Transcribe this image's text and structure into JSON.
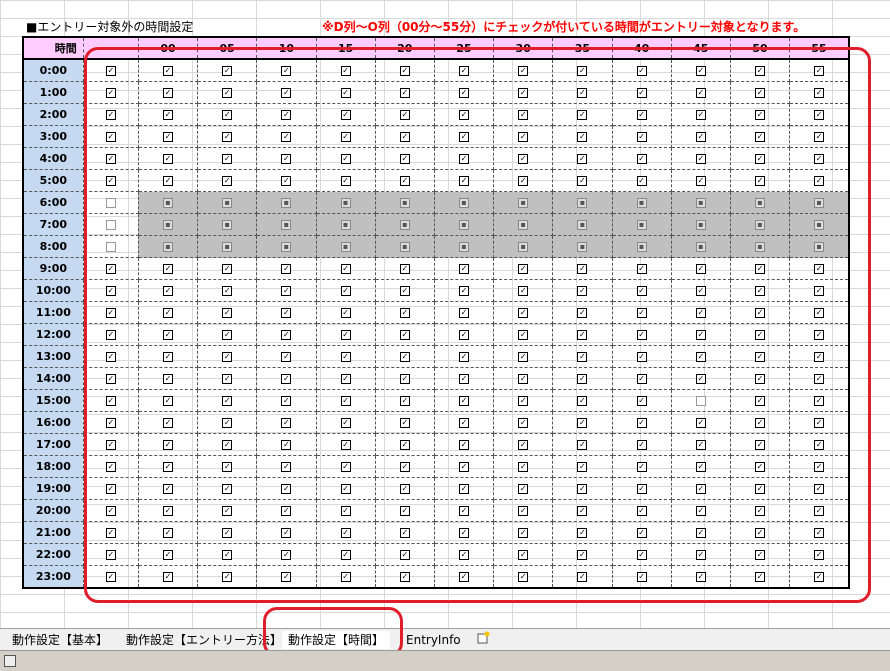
{
  "sheet": {
    "title": "■エントリー対象外の時間設定",
    "note": "※D列～O列（00分～55分）にチェックが付いている時間がエントリー対象となります。",
    "hour_header": "時間",
    "minute_headers": [
      "00",
      "05",
      "10",
      "15",
      "20",
      "25",
      "30",
      "35",
      "40",
      "45",
      "50",
      "55"
    ],
    "checkbox_states_legend": {
      "checked": "☑",
      "unchecked": "☐",
      "disabled": "▩"
    }
  },
  "rows": [
    {
      "hour": "0:00",
      "master": "checked",
      "minutes": "checked",
      "gray": false
    },
    {
      "hour": "1:00",
      "master": "checked",
      "minutes": "checked",
      "gray": false
    },
    {
      "hour": "2:00",
      "master": "checked",
      "minutes": "checked",
      "gray": false
    },
    {
      "hour": "3:00",
      "master": "checked",
      "minutes": "checked",
      "gray": false
    },
    {
      "hour": "4:00",
      "master": "checked",
      "minutes": "checked",
      "gray": false
    },
    {
      "hour": "5:00",
      "master": "checked",
      "minutes": "checked",
      "gray": false
    },
    {
      "hour": "6:00",
      "master": "unchecked",
      "minutes": "disabled",
      "gray": true
    },
    {
      "hour": "7:00",
      "master": "unchecked",
      "minutes": "disabled",
      "gray": true
    },
    {
      "hour": "8:00",
      "master": "unchecked",
      "minutes": "disabled",
      "gray": true
    },
    {
      "hour": "9:00",
      "master": "checked",
      "minutes": "checked",
      "gray": false
    },
    {
      "hour": "10:00",
      "master": "checked",
      "minutes": "checked",
      "gray": false
    },
    {
      "hour": "11:00",
      "master": "checked",
      "minutes": "checked",
      "gray": false
    },
    {
      "hour": "12:00",
      "master": "checked",
      "minutes": "checked",
      "gray": false
    },
    {
      "hour": "13:00",
      "master": "checked",
      "minutes": "checked",
      "gray": false
    },
    {
      "hour": "14:00",
      "master": "checked",
      "minutes": "checked",
      "gray": false
    },
    {
      "hour": "15:00",
      "master": "checked",
      "minutes": "checked",
      "gray": false,
      "unchecked_minutes": [
        "45"
      ]
    },
    {
      "hour": "16:00",
      "master": "checked",
      "minutes": "checked",
      "gray": false
    },
    {
      "hour": "17:00",
      "master": "checked",
      "minutes": "checked",
      "gray": false
    },
    {
      "hour": "18:00",
      "master": "checked",
      "minutes": "checked",
      "gray": false
    },
    {
      "hour": "19:00",
      "master": "checked",
      "minutes": "checked",
      "gray": false
    },
    {
      "hour": "20:00",
      "master": "checked",
      "minutes": "checked",
      "gray": false
    },
    {
      "hour": "21:00",
      "master": "checked",
      "minutes": "checked",
      "gray": false
    },
    {
      "hour": "22:00",
      "master": "checked",
      "minutes": "checked",
      "gray": false
    },
    {
      "hour": "23:00",
      "master": "checked",
      "minutes": "checked",
      "gray": false
    }
  ],
  "tabs": [
    {
      "label": "動作設定【基本】",
      "active": false
    },
    {
      "label": "動作設定【エントリー方法】",
      "active": false
    },
    {
      "label": "動作設定【時間】",
      "active": true
    },
    {
      "label": "EntryInfo",
      "active": false
    }
  ],
  "insert_sheet_icon": "new-sheet-icon",
  "colors": {
    "highlight_box": "#e01e2b",
    "header_bg": "#ffccff",
    "hour_bg": "#c5d9f1",
    "disabled_row_bg": "#c0c0c0",
    "note_text": "#ff0000"
  }
}
